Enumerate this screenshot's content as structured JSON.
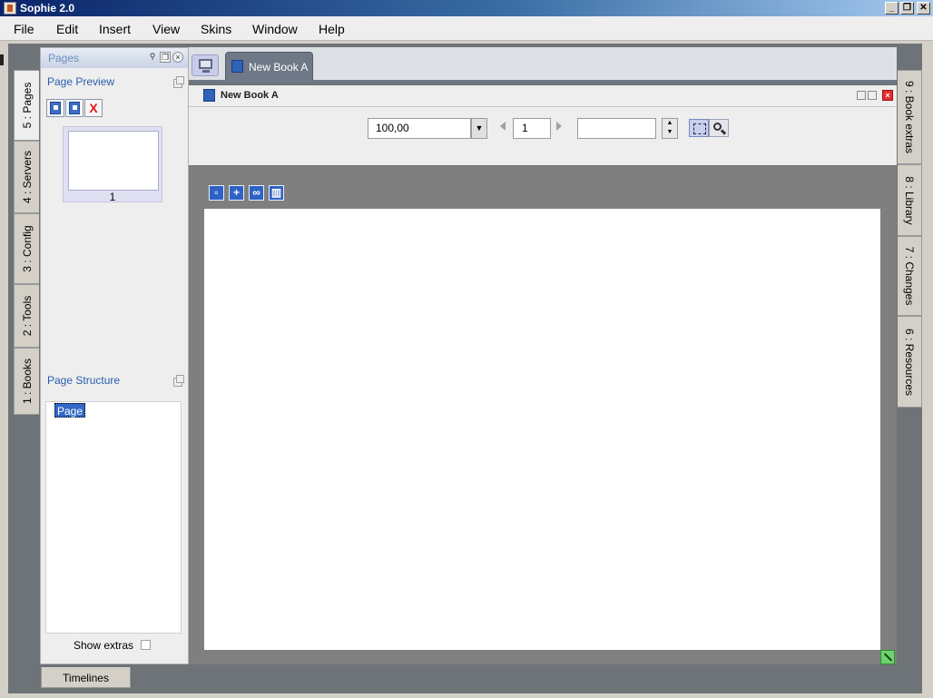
{
  "window": {
    "title": "Sophie 2.0"
  },
  "menu": [
    {
      "label": "File"
    },
    {
      "label": "Edit"
    },
    {
      "label": "Insert"
    },
    {
      "label": "View"
    },
    {
      "label": "Skins"
    },
    {
      "label": "Window"
    },
    {
      "label": "Help"
    }
  ],
  "left_tabs": [
    {
      "label": "5 : Pages",
      "active": true
    },
    {
      "label": "4 : Servers"
    },
    {
      "label": "3 : Config"
    },
    {
      "label": "2 : Tools"
    },
    {
      "label": "1 : Books"
    }
  ],
  "right_tabs": [
    {
      "label": "9 : Book extras"
    },
    {
      "label": "8 : Library"
    },
    {
      "label": "7 : Changes"
    },
    {
      "label": "6 : Resources"
    }
  ],
  "pages_panel": {
    "title": "Pages",
    "preview_label": "Page Preview",
    "page_number": "1",
    "structure_label": "Page Structure",
    "tree_root": "Page",
    "show_extras_label": "Show extras",
    "show_extras_checked": false
  },
  "bottom_tab": {
    "label": "Timelines"
  },
  "document": {
    "tab_label": "New Book A",
    "header_title": "New Book A",
    "zoom_value": "100,00",
    "page_value": "1",
    "blank_value": ""
  },
  "colors": {
    "titlebar_start": "#0a246a",
    "accent_blue": "#2f62c4",
    "canvas_gray": "#7f7f7f",
    "close_red": "#e03030"
  }
}
